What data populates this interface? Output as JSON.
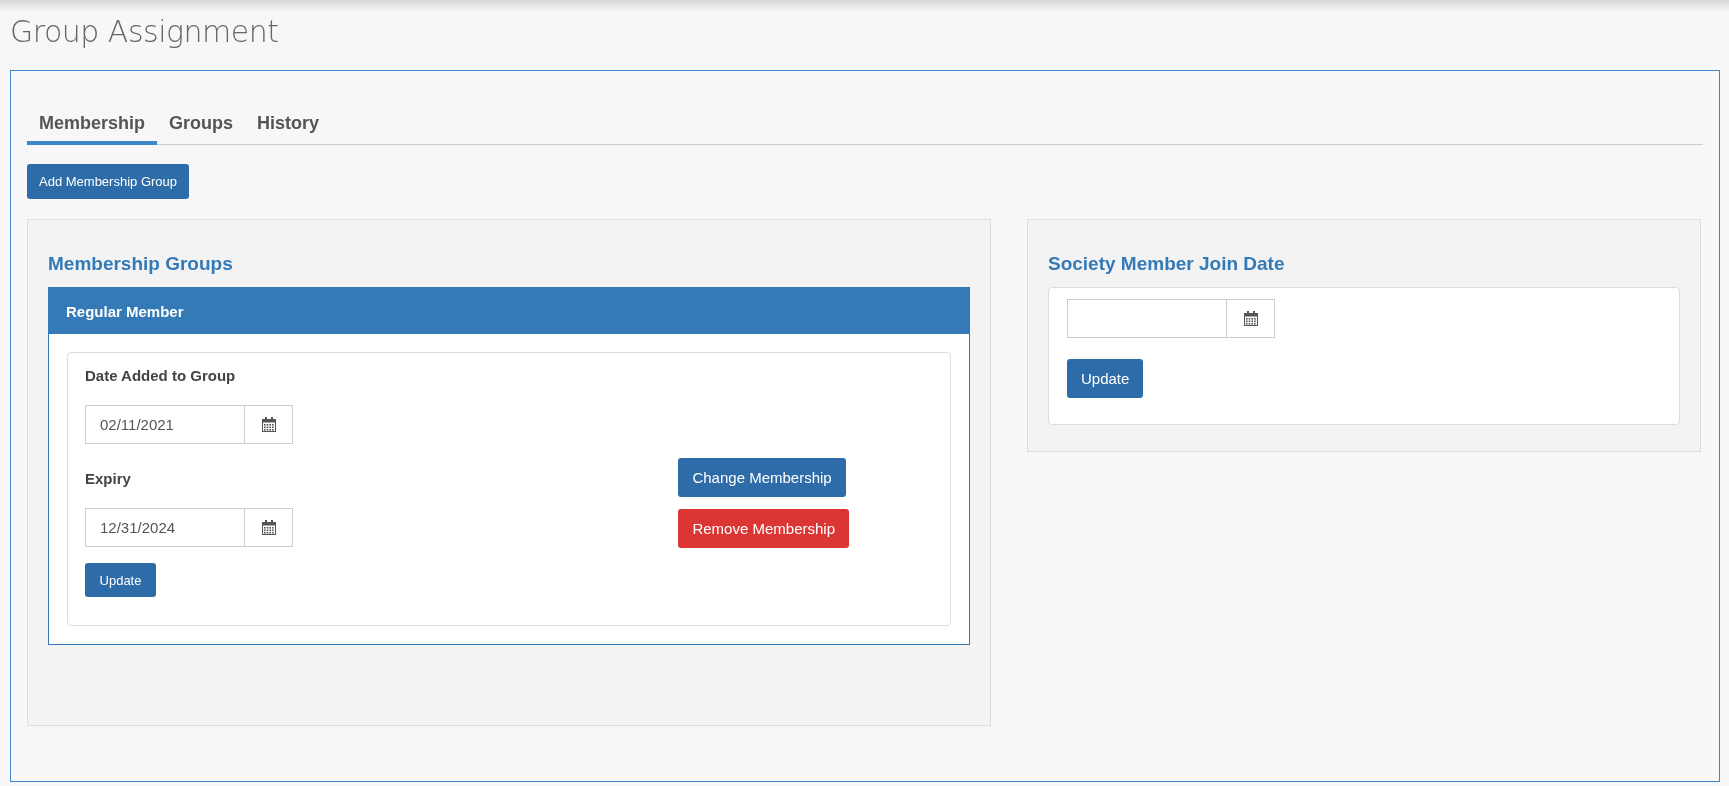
{
  "page": {
    "title": "Group Assignment"
  },
  "tabs": [
    {
      "label": "Membership",
      "selected": true
    },
    {
      "label": "Groups",
      "selected": false
    },
    {
      "label": "History",
      "selected": false
    }
  ],
  "add_button": "Add Membership Group",
  "membership_groups": {
    "heading": "Membership Groups",
    "groups": [
      {
        "name": "Regular Member",
        "fields": [
          {
            "label": "Date Added to Group",
            "value": "02/11/2021"
          },
          {
            "label": "Expiry",
            "value": "12/31/2024"
          }
        ],
        "update_button": "Update",
        "actions": [
          {
            "label": "Change Membership",
            "kind": "primary"
          },
          {
            "label": "Remove Membership",
            "kind": "danger"
          }
        ]
      }
    ]
  },
  "join_date": {
    "heading": "Society Member Join Date",
    "update_button": "Update"
  }
}
